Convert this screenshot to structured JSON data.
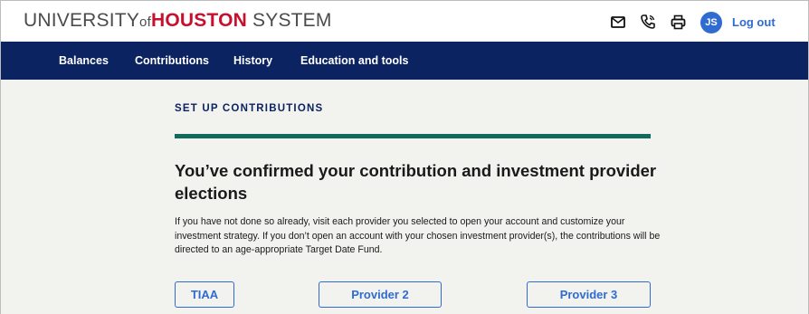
{
  "header": {
    "brand": {
      "part1": "UNIVERSITY",
      "part2": "of",
      "part3": "HOUSTON",
      "part4": "SYSTEM"
    },
    "icons": [
      "mail-icon",
      "phone-icon",
      "printer-icon"
    ],
    "avatar_initials": "JS",
    "logout_label": "Log out"
  },
  "nav": {
    "items": [
      {
        "label": "Balances"
      },
      {
        "label": "Contributions"
      },
      {
        "label": "History"
      },
      {
        "label": "Education and tools"
      }
    ]
  },
  "main": {
    "eyebrow": "SET UP CONTRIBUTIONS",
    "heading": "You’ve confirmed your contribution and investment provider elections",
    "body": " If you have not done so already, visit each provider you selected to open your account and customize your investment strategy. If you don’t open an account with your chosen investment provider(s), the contributions will be directed to an age-appropriate Target Date Fund.",
    "providers": [
      {
        "label": "TIAA"
      },
      {
        "label": "Provider 2"
      },
      {
        "label": "Provider 3"
      }
    ]
  },
  "colors": {
    "brand_red": "#c8102e",
    "nav_bg": "#0b2361",
    "accent_blue": "#2f6bd1",
    "divider_green": "#106b5c",
    "page_bg": "#f2f2ee"
  }
}
